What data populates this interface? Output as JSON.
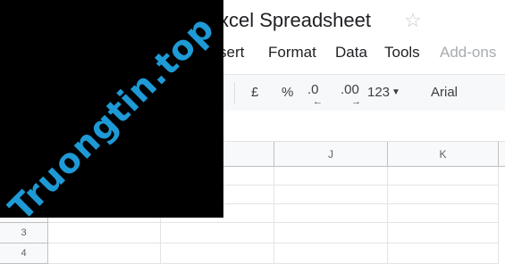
{
  "app": {
    "title": "xcel Spreadsheet",
    "star_icon": "star-icon"
  },
  "menu": {
    "items": [
      {
        "label": "sert",
        "disabled": false
      },
      {
        "label": "Format",
        "disabled": false
      },
      {
        "label": "Data",
        "disabled": false
      },
      {
        "label": "Tools",
        "disabled": false
      },
      {
        "label": "Add-ons",
        "disabled": true
      }
    ]
  },
  "toolbar": {
    "currency": "£",
    "percent": "%",
    "decrease_decimal": ".0",
    "increase_decimal": ".00",
    "more_formats": "123",
    "font": "Arial"
  },
  "grid": {
    "columns": [
      "J",
      "K"
    ],
    "rows": [
      "3",
      "4"
    ]
  },
  "watermark": {
    "text": "Truongtin.top",
    "color": "#1e9ad6"
  }
}
